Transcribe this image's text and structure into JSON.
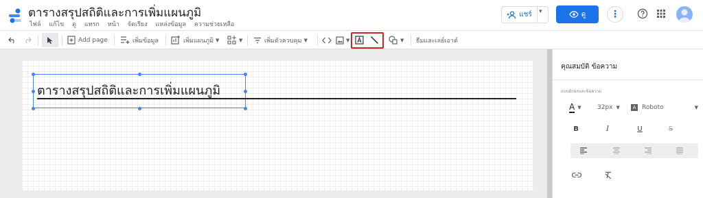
{
  "header": {
    "title": "ตารางสรุปสถิติและการเพิ่มแผนภูมิ",
    "menu": [
      "ไฟล์",
      "แก้ไข",
      "ดู",
      "แทรก",
      "หน้า",
      "จัดเรียง",
      "แหล่งข้อมูล",
      "ความช่วยเหลือ"
    ],
    "share_label": "แชร์",
    "view_label": "ดู",
    "more_label": "⋮"
  },
  "toolbar": {
    "add_page": "Add page",
    "add_data": "เพิ่มข้อมูล",
    "add_chart": "เพิ่มแผนภูมิ",
    "add_filter": "เพิ่มตัวควบคุม",
    "theme_layout": "ธีมและเลย์เอาต์"
  },
  "canvas": {
    "title_text": "ตารางสรุปสถิติและการเพิ่มแผนภูมิ"
  },
  "panel": {
    "title": "คุณสมบัติ ข้อความ",
    "subtitle": "แบบอักษรและข้อความ",
    "font_size": "32px",
    "font_family": "Roboto",
    "bold": "B",
    "italic": "I",
    "underline": "U",
    "strike": "S"
  },
  "colors": {
    "accent": "#1a73e8",
    "highlight": "#c62828",
    "selection": "#4285f4"
  }
}
